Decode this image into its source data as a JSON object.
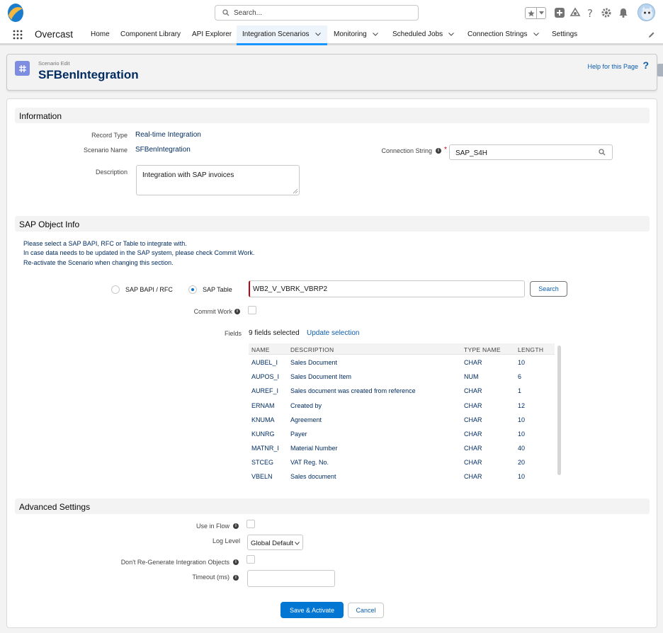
{
  "header": {
    "search_placeholder": "Search...",
    "app_name": "Overcast"
  },
  "nav": {
    "items": [
      {
        "label": "Home"
      },
      {
        "label": "Component Library"
      },
      {
        "label": "API Explorer"
      },
      {
        "label": "Integration Scenarios"
      },
      {
        "label": "Monitoring"
      },
      {
        "label": "Scheduled Jobs"
      },
      {
        "label": "Connection Strings"
      },
      {
        "label": "Settings"
      }
    ],
    "active": "Integration Scenarios"
  },
  "page": {
    "eyebrow": "Scenario Edit",
    "title": "SFBenIntegration",
    "help_link": "Help for this Page",
    "help_icon": "?"
  },
  "information": {
    "section_title": "Information",
    "record_type_label": "Record Type",
    "record_type_value": "Real-time Integration",
    "scenario_name_label": "Scenario Name",
    "scenario_name_value": "SFBenIntegration",
    "connection_string_label": "Connection String",
    "connection_string_value": "SAP_S4H",
    "description_label": "Description",
    "description_value": "Integration with SAP invoices"
  },
  "sap_object": {
    "section_title": "SAP Object Info",
    "instructions": [
      "Please select a SAP BAPI, RFC or Table to integrate with.",
      "In case data needs to be updated in the SAP system, please check Commit Work.",
      "Re-activate the Scenario when changing this section."
    ],
    "radio_bapi_label": "SAP BAPI / RFC",
    "radio_table_label": "SAP Table",
    "selected_option": "SAP Table",
    "object_input_value": "WB2_V_VBRK_VBRP2",
    "search_button": "Search",
    "commit_work_label": "Commit Work",
    "commit_work_checked": false,
    "fields_label": "Fields",
    "fields_selected": "9 fields selected",
    "update_selection": "Update selection",
    "table": {
      "columns": [
        "NAME",
        "DESCRIPTION",
        "TYPE NAME",
        "LENGTH"
      ],
      "rows": [
        [
          "AUBEL_I",
          "Sales Document",
          "CHAR",
          "10"
        ],
        [
          "AUPOS_I",
          "Sales Document Item",
          "NUM",
          "6"
        ],
        [
          "AUREF_I",
          "Sales document was created from reference",
          "CHAR",
          "1"
        ],
        [
          "ERNAM",
          "Created by",
          "CHAR",
          "12"
        ],
        [
          "KNUMA",
          "Agreement",
          "CHAR",
          "10"
        ],
        [
          "KUNRG",
          "Payer",
          "CHAR",
          "10"
        ],
        [
          "MATNR_I",
          "Material Number",
          "CHAR",
          "40"
        ],
        [
          "STCEG",
          "VAT Reg. No.",
          "CHAR",
          "20"
        ],
        [
          "VBELN",
          "Sales document",
          "CHAR",
          "10"
        ]
      ]
    }
  },
  "advanced": {
    "section_title": "Advanced Settings",
    "use_in_flow_label": "Use in Flow",
    "use_in_flow_checked": false,
    "log_level_label": "Log Level",
    "log_level_value": "Global Default",
    "dont_regen_label": "Don't Re-Generate Integration Objects",
    "dont_regen_checked": false,
    "timeout_label": "Timeout (ms)",
    "timeout_value": ""
  },
  "footer": {
    "save_button": "Save & Activate",
    "cancel_button": "Cancel"
  },
  "colors": {
    "brand": "#0176d3",
    "title": "#032d60",
    "link": "#0b5cab",
    "page_icon": "#7f8de1",
    "required": "#ba0517"
  }
}
